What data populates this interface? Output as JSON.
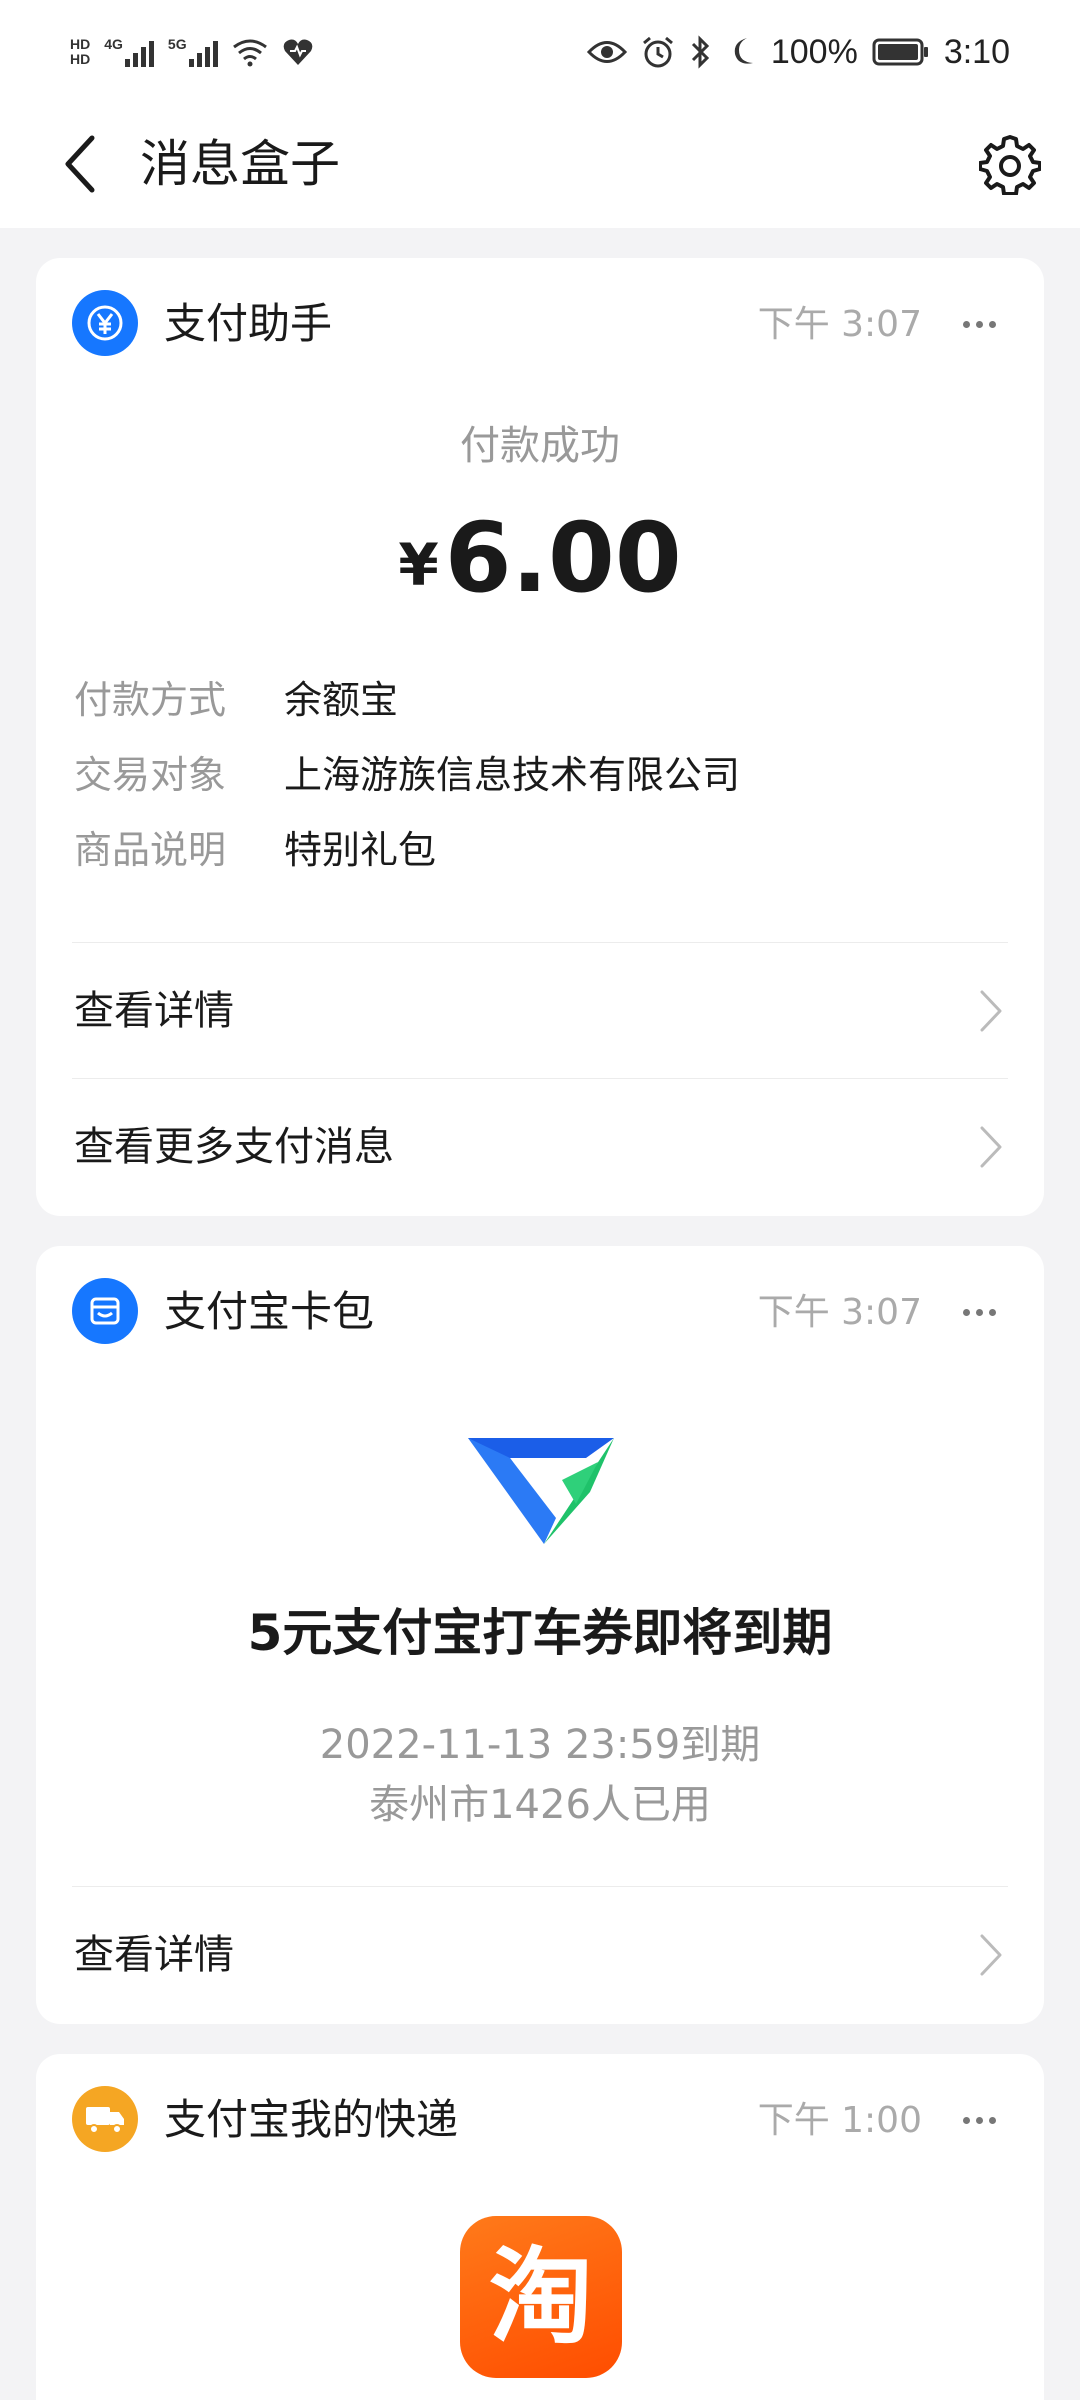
{
  "status_bar": {
    "hd_top": "HD",
    "hd_bottom": "HD",
    "net1": "4G",
    "net2": "5G",
    "battery": "100%",
    "time": "3:10"
  },
  "header": {
    "title": "消息盒子"
  },
  "cards": {
    "payment": {
      "title": "支付助手",
      "time": "下午 3:07",
      "status": "付款成功",
      "currency": "¥",
      "amount": "6.00",
      "details": [
        {
          "key": "付款方式",
          "value": "余额宝"
        },
        {
          "key": "交易对象",
          "value": "上海游族信息技术有限公司"
        },
        {
          "key": "商品说明",
          "value": "特别礼包"
        }
      ],
      "links": [
        {
          "label": "查看详情"
        },
        {
          "label": "查看更多支付消息"
        }
      ]
    },
    "cardpack": {
      "title": "支付宝卡包",
      "time": "下午 3:07",
      "headline": "5元支付宝打车券即将到期",
      "expiry": "2022-11-13 23:59到期",
      "usage": "泰州市1426人已用",
      "link": "查看详情"
    },
    "express": {
      "title": "支付宝我的快递",
      "time": "下午 1:00",
      "app_glyph": "淘"
    }
  },
  "icons": {
    "status": [
      "signal-icon",
      "wifi-icon",
      "heart-icon",
      "eye-icon",
      "alarm-icon",
      "bluetooth-icon",
      "moon-icon",
      "battery-icon"
    ],
    "header": [
      "back-arrow-icon",
      "gear-icon"
    ],
    "cards": [
      "yuan-icon",
      "wallet-icon",
      "truck-icon",
      "taxi-logo-icon",
      "taobao-icon"
    ]
  },
  "colors": {
    "accent_blue": "#1677ff",
    "express_orange": "#f5a623",
    "taobao_orange": "#ff5000",
    "logo_green": "#2fd07a"
  }
}
